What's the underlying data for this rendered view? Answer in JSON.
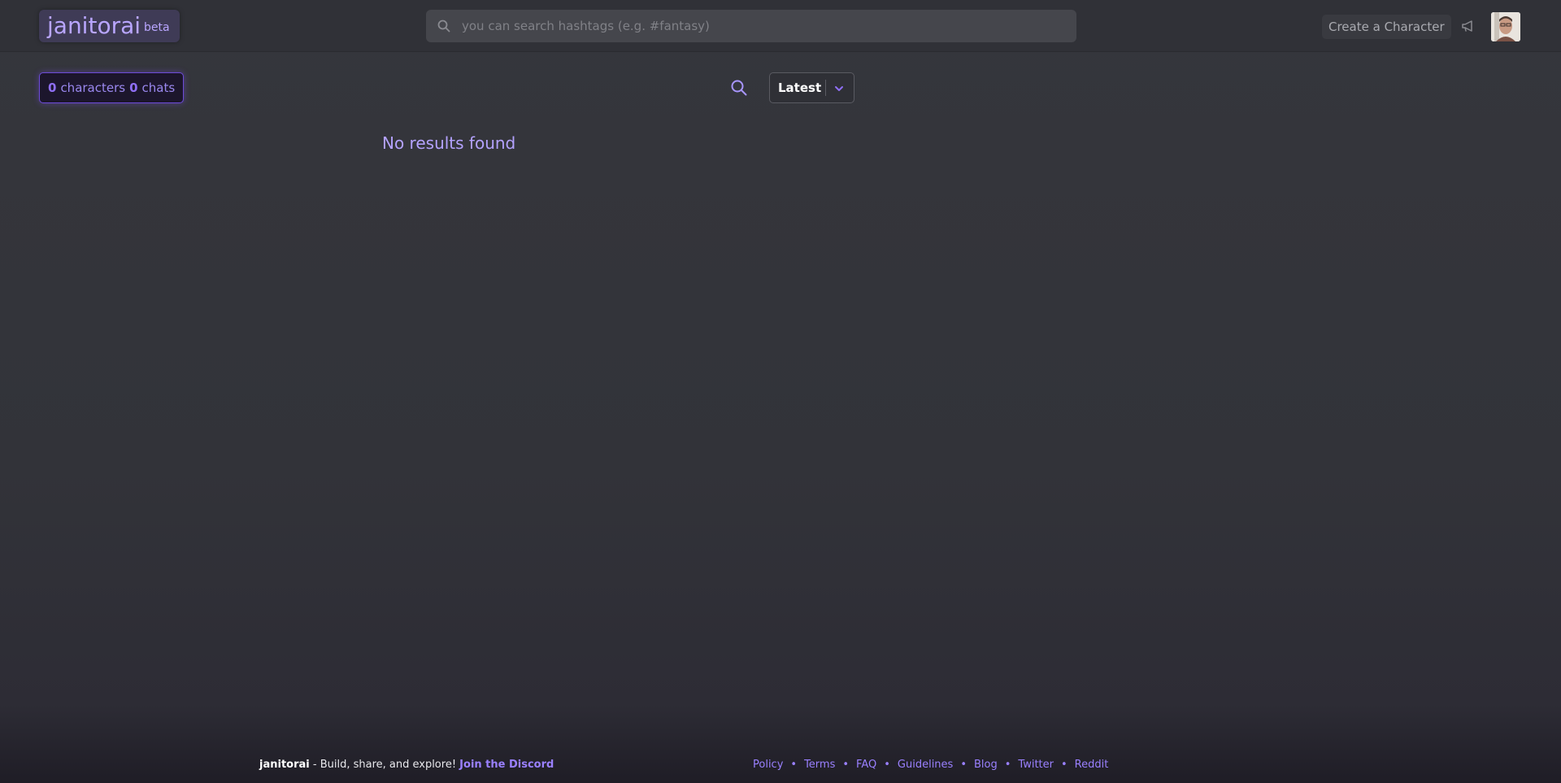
{
  "header": {
    "logo_text": "janitorai",
    "logo_badge": "beta",
    "search_placeholder": "you can search hashtags (e.g. #fantasy)",
    "search_value": "",
    "create_label": "Create a Character"
  },
  "toolbar": {
    "characters_count": "0",
    "characters_label": "characters",
    "chats_count": "0",
    "chats_label": "chats",
    "sort_value": "Latest"
  },
  "main": {
    "empty_message": "No results found"
  },
  "footer": {
    "brand": "janitorai",
    "tagline": " - Build, share, and explore! ",
    "discord_label": "Join the Discord",
    "links": [
      "Policy",
      "Terms",
      "FAQ",
      "Guidelines",
      "Blog",
      "Twitter",
      "Reddit"
    ]
  },
  "icons": {
    "search": "search-icon",
    "megaphone": "megaphone-icon",
    "chevron": "chevron-down-icon"
  },
  "colors": {
    "accent": "#9a80ff",
    "background": "#323339",
    "header": "#303137"
  }
}
